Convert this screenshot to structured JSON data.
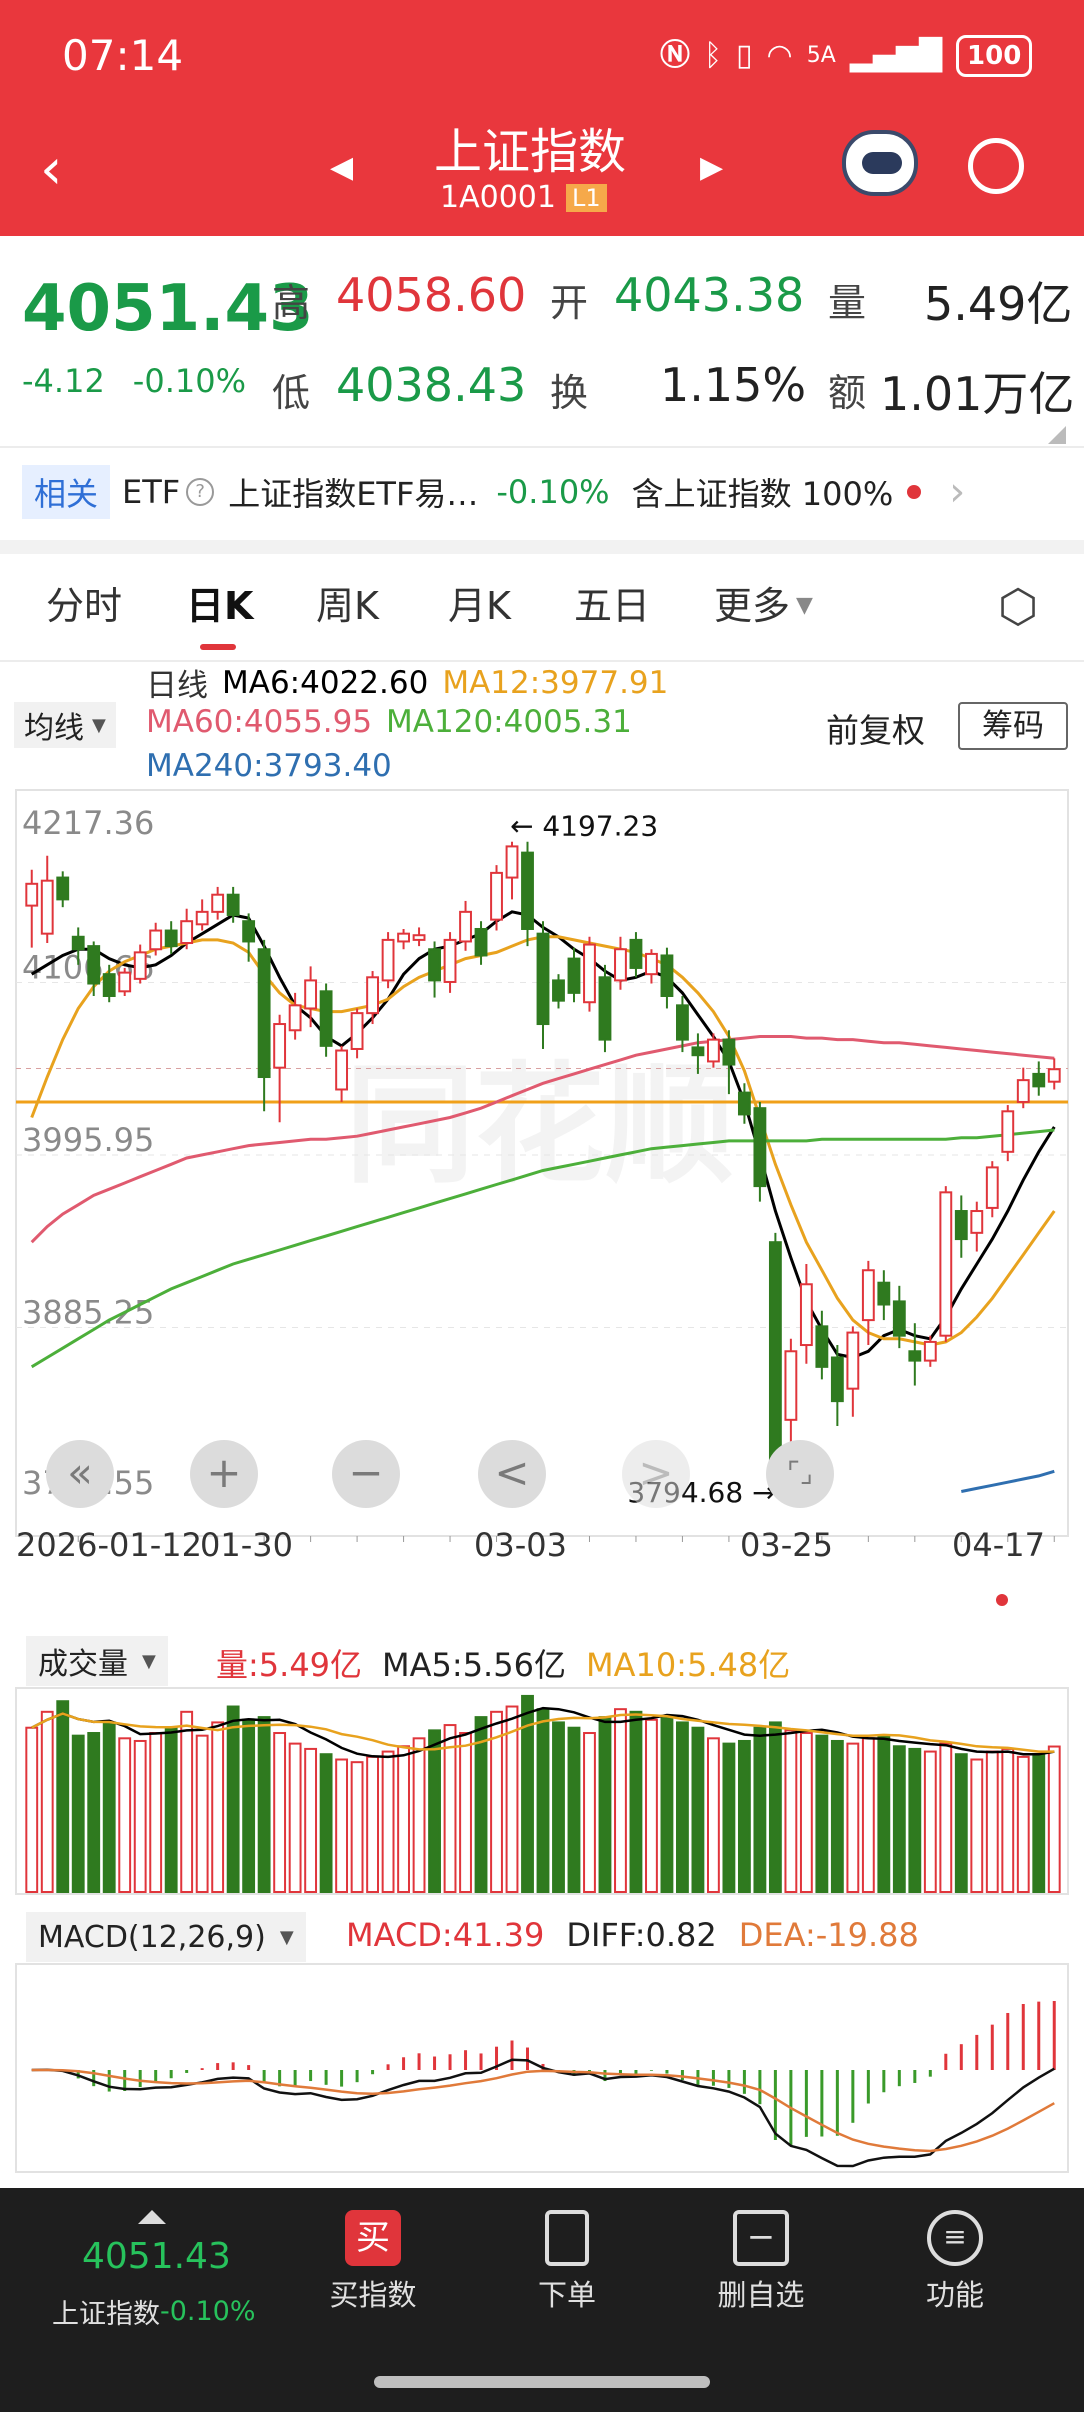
{
  "status": {
    "time": "07:14",
    "network": "5A",
    "battery": "100"
  },
  "header": {
    "title": "上证指数",
    "code": "1A0001",
    "level": "L1"
  },
  "quote": {
    "price": "4051.43",
    "change": "-4.12",
    "change_pct": "-0.10%",
    "high_label": "高",
    "high": "4058.60",
    "open_label": "开",
    "open": "4043.38",
    "vol_label": "量",
    "vol": "5.49亿",
    "low_label": "低",
    "low": "4038.43",
    "turn_label": "换",
    "turn": "1.15%",
    "amt_label": "额",
    "amt": "1.01万亿"
  },
  "related": {
    "tag": "相关",
    "type": "ETF",
    "etf_name": "上证指数ETF易…",
    "etf_change": "-0.10%",
    "holding": "含上证指数 100%"
  },
  "tabs": [
    "分时",
    "日K",
    "周K",
    "月K",
    "五日",
    "更多"
  ],
  "ma_legend": {
    "select": "均线",
    "title": "日线",
    "ma6": "MA6:4022.60",
    "ma12": "MA12:3977.91",
    "ma60": "MA60:4055.95",
    "ma120": "MA120:4005.31",
    "ma240": "MA240:3793.40",
    "fq": "前复权",
    "chip": "筹码"
  },
  "chart_data": {
    "type": "candlestick",
    "y_ticks": [
      "4217.36",
      "4106.66",
      "3995.95",
      "3885.25",
      "3774.55"
    ],
    "y_range": [
      3774.55,
      4217.36
    ],
    "x_ticks": [
      "2026-01-12",
      "01-30",
      "03-03",
      "03-25",
      "04-17"
    ],
    "max_label": "4197.23",
    "min_label": "3794.68",
    "ref_line": 4030,
    "candles": [
      [
        4156,
        4170,
        4129,
        4179
      ],
      [
        4138,
        4172,
        4132,
        4188
      ],
      [
        4174,
        4160,
        4155,
        4178
      ],
      [
        4136,
        4128,
        4118,
        4142
      ],
      [
        4130,
        4106,
        4098,
        4133
      ],
      [
        4112,
        4098,
        4094,
        4118
      ],
      [
        4101,
        4113,
        4098,
        4116
      ],
      [
        4109,
        4126,
        4106,
        4131
      ],
      [
        4128,
        4140,
        4124,
        4145
      ],
      [
        4140,
        4130,
        4125,
        4146
      ],
      [
        4132,
        4146,
        4128,
        4154
      ],
      [
        4144,
        4152,
        4140,
        4160
      ],
      [
        4152,
        4163,
        4147,
        4168
      ],
      [
        4163,
        4150,
        4145,
        4168
      ],
      [
        4146,
        4133,
        4120,
        4151
      ],
      [
        4128,
        4046,
        4024,
        4134
      ],
      [
        4052,
        4080,
        4017,
        4086
      ],
      [
        4076,
        4092,
        4070,
        4100
      ],
      [
        4090,
        4108,
        4078,
        4117
      ],
      [
        4101,
        4066,
        4059,
        4106
      ],
      [
        4038,
        4063,
        4030,
        4066
      ],
      [
        4064,
        4087,
        4058,
        4090
      ],
      [
        4087,
        4110,
        4080,
        4114
      ],
      [
        4108,
        4134,
        4103,
        4139
      ],
      [
        4133,
        4138,
        4128,
        4141
      ],
      [
        4134,
        4137,
        4130,
        4142
      ],
      [
        4128,
        4108,
        4097,
        4133
      ],
      [
        4107,
        4134,
        4100,
        4139
      ],
      [
        4133,
        4152,
        4127,
        4159
      ],
      [
        4141,
        4124,
        4118,
        4146
      ],
      [
        4147,
        4177,
        4140,
        4182
      ],
      [
        4174,
        4194,
        4160,
        4197
      ],
      [
        4190,
        4141,
        4130,
        4197
      ],
      [
        4138,
        4080,
        4064,
        4146
      ],
      [
        4108,
        4095,
        4090,
        4112
      ],
      [
        4122,
        4100,
        4094,
        4129
      ],
      [
        4094,
        4131,
        4088,
        4136
      ],
      [
        4110,
        4070,
        4062,
        4118
      ],
      [
        4108,
        4128,
        4102,
        4136
      ],
      [
        4134,
        4116,
        4110,
        4139
      ],
      [
        4112,
        4125,
        4106,
        4128
      ],
      [
        4124,
        4098,
        4090,
        4129
      ],
      [
        4092,
        4070,
        4062,
        4098
      ],
      [
        4065,
        4060,
        4048,
        4074
      ],
      [
        4056,
        4070,
        4052,
        4074
      ],
      [
        4070,
        4054,
        4035,
        4076
      ],
      [
        4036,
        4022,
        4016,
        4042
      ],
      [
        4026,
        3976,
        3966,
        4030
      ],
      [
        3940,
        3800,
        3795,
        3946
      ],
      [
        3826,
        3870,
        3806,
        3878
      ],
      [
        3874,
        3913,
        3862,
        3926
      ],
      [
        3886,
        3860,
        3852,
        3896
      ],
      [
        3866,
        3838,
        3822,
        3874
      ],
      [
        3846,
        3882,
        3828,
        3886
      ],
      [
        3890,
        3922,
        3874,
        3928
      ],
      [
        3914,
        3900,
        3890,
        3922
      ],
      [
        3902,
        3880,
        3872,
        3912
      ],
      [
        3870,
        3864,
        3848,
        3888
      ],
      [
        3864,
        3876,
        3860,
        3880
      ],
      [
        3880,
        3972,
        3876,
        3976
      ],
      [
        3960,
        3942,
        3930,
        3970
      ],
      [
        3946,
        3960,
        3934,
        3966
      ],
      [
        3962,
        3988,
        3956,
        3992
      ],
      [
        3998,
        4024,
        3992,
        4028
      ],
      [
        4030,
        4044,
        4026,
        4052
      ],
      [
        4048,
        4040,
        4034,
        4056
      ],
      [
        4043,
        4051,
        4038,
        4058
      ]
    ],
    "ma_series": [
      {
        "name": "MA6",
        "color": "#000000",
        "values": [
          4112,
          4118,
          4124,
          4128,
          4128,
          4122,
          4118,
          4116,
          4118,
          4124,
          4132,
          4138,
          4144,
          4150,
          4148,
          4130,
          4110,
          4092,
          4084,
          4072,
          4066,
          4074,
          4084,
          4096,
          4112,
          4122,
          4128,
          4130,
          4134,
          4138,
          4146,
          4152,
          4150,
          4142,
          4136,
          4128,
          4122,
          4114,
          4108,
          4110,
          4114,
          4110,
          4100,
          4086,
          4072,
          4056,
          4030,
          3996,
          3960,
          3930,
          3902,
          3884,
          3868,
          3866,
          3870,
          3880,
          3884,
          3880,
          3878,
          3892,
          3910,
          3926,
          3942,
          3960,
          3980,
          3998,
          4014
        ]
      },
      {
        "name": "MA12",
        "color": "#e8a21e",
        "values": [
          4020,
          4046,
          4070,
          4090,
          4104,
          4114,
          4120,
          4124,
          4128,
          4130,
          4132,
          4134,
          4134,
          4132,
          4126,
          4112,
          4100,
          4092,
          4090,
          4088,
          4088,
          4090,
          4092,
          4096,
          4104,
          4110,
          4114,
          4118,
          4122,
          4124,
          4126,
          4130,
          4134,
          4136,
          4136,
          4134,
          4132,
          4130,
          4128,
          4126,
          4122,
          4118,
          4110,
          4100,
          4088,
          4072,
          4050,
          4020,
          3990,
          3964,
          3940,
          3922,
          3904,
          3890,
          3882,
          3878,
          3878,
          3876,
          3874,
          3876,
          3882,
          3892,
          3904,
          3918,
          3932,
          3946,
          3960
        ]
      },
      {
        "name": "MA60",
        "color": "#e05a6f",
        "values": [
          3940,
          3950,
          3958,
          3964,
          3970,
          3974,
          3978,
          3982,
          3986,
          3990,
          3994,
          3996,
          3998,
          4000,
          4002,
          4003,
          4004,
          4005,
          4006,
          4006,
          4007,
          4008,
          4010,
          4012,
          4014,
          4016,
          4018,
          4020,
          4023,
          4026,
          4030,
          4034,
          4038,
          4042,
          4045,
          4048,
          4051,
          4054,
          4057,
          4060,
          4062,
          4064,
          4066,
          4068,
          4069,
          4070,
          4071,
          4072,
          4072,
          4072,
          4071,
          4071,
          4070,
          4070,
          4069,
          4068,
          4068,
          4067,
          4066,
          4065,
          4064,
          4063,
          4062,
          4061,
          4060,
          4059,
          4058
        ]
      },
      {
        "name": "MA120",
        "color": "#4caf3a",
        "values": [
          3860,
          3866,
          3872,
          3878,
          3884,
          3890,
          3895,
          3900,
          3905,
          3910,
          3914,
          3918,
          3922,
          3926,
          3929,
          3932,
          3935,
          3938,
          3941,
          3944,
          3947,
          3950,
          3953,
          3956,
          3959,
          3962,
          3965,
          3968,
          3971,
          3974,
          3977,
          3980,
          3983,
          3986,
          3988,
          3990,
          3992,
          3994,
          3996,
          3998,
          4000,
          4001,
          4002,
          4003,
          4004,
          4005,
          4005,
          4005,
          4005,
          4005,
          4005,
          4006,
          4006,
          4006,
          4006,
          4006,
          4006,
          4006,
          4006,
          4006,
          4007,
          4007,
          4008,
          4009,
          4010,
          4011,
          4012
        ]
      },
      {
        "name": "MA240",
        "color": "#2f6fb0",
        "values": [
          null,
          null,
          null,
          null,
          null,
          null,
          null,
          null,
          null,
          null,
          null,
          null,
          null,
          null,
          null,
          null,
          null,
          null,
          null,
          null,
          null,
          null,
          null,
          null,
          null,
          null,
          null,
          null,
          null,
          null,
          null,
          null,
          null,
          null,
          null,
          null,
          null,
          null,
          null,
          null,
          null,
          null,
          null,
          null,
          null,
          null,
          null,
          null,
          null,
          null,
          null,
          null,
          null,
          null,
          null,
          null,
          null,
          null,
          null,
          null,
          3780,
          3782,
          3784,
          3786,
          3788,
          3790,
          3793
        ]
      }
    ],
    "volume": {
      "title": "成交量",
      "vol": "量:5.49亿",
      "ma5": "MA5:5.56亿",
      "ma10": "MA10:5.48亿",
      "values": [
        6.2,
        6.8,
        7.2,
        5.9,
        6.0,
        6.4,
        5.8,
        5.7,
        6.0,
        6.2,
        6.8,
        5.9,
        6.4,
        7.0,
        6.5,
        6.6,
        6.0,
        5.6,
        5.4,
        5.2,
        5.0,
        4.9,
        5.1,
        5.3,
        5.5,
        5.8,
        6.1,
        6.3,
        6.0,
        6.6,
        6.8,
        7.0,
        7.4,
        6.9,
        6.4,
        6.2,
        6.0,
        6.6,
        6.9,
        6.8,
        6.5,
        6.6,
        6.4,
        6.2,
        5.8,
        5.6,
        5.7,
        6.2,
        6.4,
        6.1,
        6.0,
        5.9,
        5.7,
        5.6,
        5.8,
        5.9,
        5.5,
        5.4,
        5.3,
        5.6,
        5.2,
        5.0,
        5.3,
        5.4,
        5.1,
        5.2,
        5.49
      ]
    },
    "macd": {
      "title": "MACD(12,26,9)",
      "macd": "MACD:41.39",
      "diff": "DIFF:0.82",
      "dea": "DEA:-19.88"
    }
  },
  "controls": [
    "«",
    "+",
    "−",
    "<",
    ">",
    "⌜⌟"
  ],
  "bottom": {
    "price": "4051.43",
    "name": "上证指数",
    "pct": "-0.10%",
    "items": [
      "买指数",
      "下单",
      "删自选",
      "功能"
    ]
  }
}
